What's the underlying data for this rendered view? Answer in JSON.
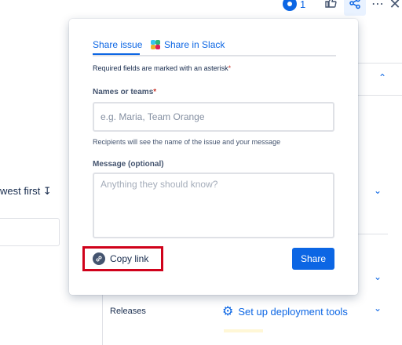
{
  "toolbar": {
    "watch_count": "1",
    "icons": [
      "watch-icon",
      "like-icon",
      "share-icon",
      "more-icon",
      "close-icon"
    ],
    "more_glyph": "⋯",
    "close_glyph": "✕",
    "like_glyph": "👍",
    "share_glyph": "<"
  },
  "background": {
    "sort_label": "west first ↧",
    "releases_label": "Releases",
    "deploy_label": "Set up deployment tools",
    "caret_glyph": "⌄",
    "caret_up_glyph": "⌃"
  },
  "popup": {
    "tab_share": "Share issue",
    "tab_slack": "Share in Slack",
    "required_note": "Required fields are marked with an asterisk",
    "asterisk": "*",
    "names_label": "Names or teams",
    "names_placeholder": "e.g. Maria, Team Orange",
    "recipients_hint": "Recipients will see the name of the issue and your message",
    "message_label": "Message (optional)",
    "message_placeholder": "Anything they should know?",
    "copy_link_label": "Copy link",
    "share_button_label": "Share",
    "copy_icon_glyph": "↗"
  },
  "colors": {
    "accent": "#0c66e4",
    "highlight_box": "#d0021b",
    "slack": [
      "#36c5f0",
      "#2eb67d",
      "#ecb22e",
      "#e01e5a"
    ]
  }
}
